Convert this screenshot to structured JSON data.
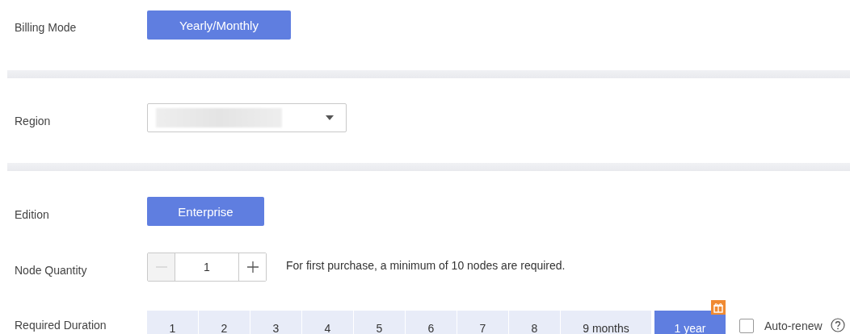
{
  "billing_mode": {
    "label": "Billing Mode",
    "options": [
      {
        "label": "Yearly/Monthly",
        "selected": true
      }
    ]
  },
  "region": {
    "label": "Region"
  },
  "edition": {
    "label": "Edition",
    "options": [
      {
        "label": "Enterprise",
        "selected": true
      }
    ]
  },
  "node_quantity": {
    "label": "Node Quantity",
    "value": "1",
    "minus_disabled": true,
    "hint": "For first purchase, a minimum of 10 nodes are required."
  },
  "required_duration": {
    "label": "Required Duration",
    "options": [
      {
        "label": "1",
        "selected": false,
        "gift": false
      },
      {
        "label": "2",
        "selected": false,
        "gift": false
      },
      {
        "label": "3",
        "selected": false,
        "gift": false
      },
      {
        "label": "4",
        "selected": false,
        "gift": false
      },
      {
        "label": "5",
        "selected": false,
        "gift": false
      },
      {
        "label": "6",
        "selected": false,
        "gift": false
      },
      {
        "label": "7",
        "selected": false,
        "gift": false
      },
      {
        "label": "8",
        "selected": false,
        "gift": false
      },
      {
        "label": "9 months",
        "selected": false,
        "gift": false
      },
      {
        "label": "1 year",
        "selected": true,
        "gift": true
      }
    ],
    "auto_renew": {
      "label": "Auto-renew",
      "checked": false
    }
  }
}
